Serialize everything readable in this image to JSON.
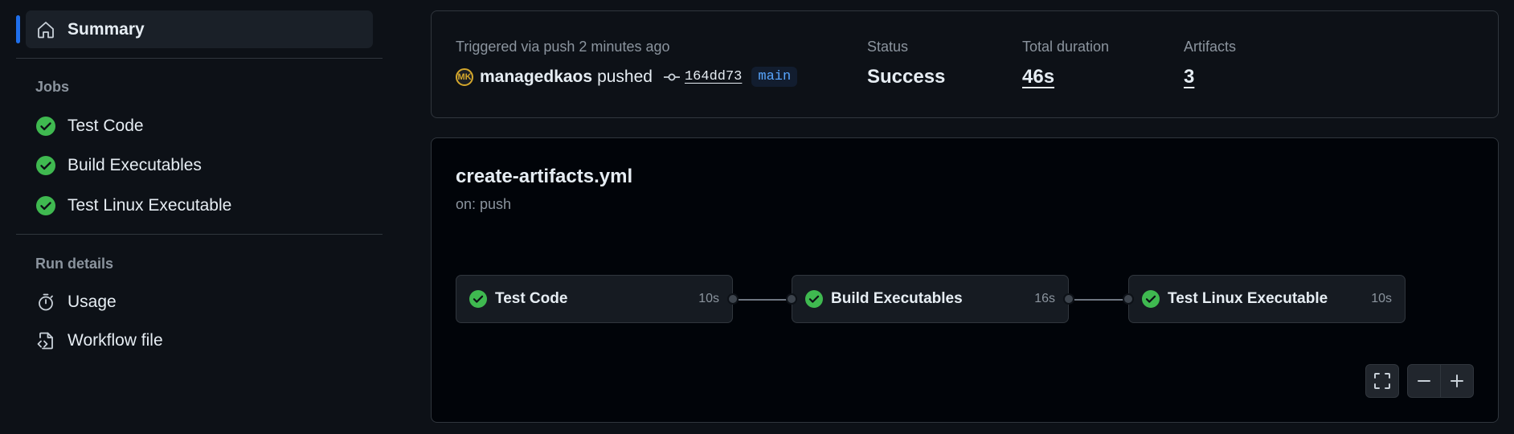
{
  "sidebar": {
    "summary": "Summary",
    "jobs_heading": "Jobs",
    "jobs": [
      {
        "label": "Test Code"
      },
      {
        "label": "Build Executables"
      },
      {
        "label": "Test Linux Executable"
      }
    ],
    "run_details_heading": "Run details",
    "usage": "Usage",
    "workflow_file": "Workflow file"
  },
  "run": {
    "triggered_label": "Triggered via push 2 minutes ago",
    "avatar_initials": "MK",
    "user": "managedkaos",
    "action": "pushed",
    "commit": "164dd73",
    "branch": "main",
    "status_label": "Status",
    "status_value": "Success",
    "duration_label": "Total duration",
    "duration_value": "46s",
    "artifacts_label": "Artifacts",
    "artifacts_value": "3"
  },
  "workflow": {
    "name": "create-artifacts.yml",
    "trigger": "on: push",
    "jobs": [
      {
        "name": "Test Code",
        "duration": "10s"
      },
      {
        "name": "Build Executables",
        "duration": "16s"
      },
      {
        "name": "Test Linux Executable",
        "duration": "10s"
      }
    ]
  },
  "colors": {
    "success": "#3fb950",
    "accent": "#1f6feb",
    "link": "#58a6ff"
  }
}
